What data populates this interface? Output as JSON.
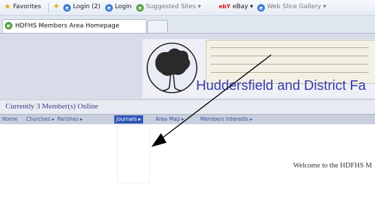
{
  "favorites_bar": {
    "favorites_label": "Favorites",
    "links": [
      {
        "label": "Login (2)",
        "icon": "ie-page-icon"
      },
      {
        "label": "Login",
        "icon": "ie-page-icon"
      },
      {
        "label": "Suggested Sites ▾",
        "icon": "suggested-sites-icon"
      },
      {
        "label": "eBay ▾",
        "icon": "ebay-icon"
      },
      {
        "label": "Web Slice Gallery ▾",
        "icon": "ie-page-icon"
      }
    ]
  },
  "tabs": [
    {
      "label": "HDFHS Members Area Homepage"
    }
  ],
  "banner": {
    "title": "Huddersfield and District Fa",
    "logo": "tree-circle-logo"
  },
  "online_status": "Currently 3 Member(s) Online",
  "nav": {
    "items": [
      {
        "label": "Home"
      },
      {
        "label": "Churches ▸"
      },
      {
        "label": "Parishes ▸"
      },
      {
        "label": "Journals ▸",
        "active": true
      },
      {
        "label": "Area Map ▸"
      },
      {
        "label": "Members Interests ▸"
      }
    ]
  },
  "welcome_text": "Welcome to the HDFHS M",
  "colors": {
    "nav_active": "#2f55b8",
    "title": "#3b3baa",
    "arrow": "#000000"
  }
}
